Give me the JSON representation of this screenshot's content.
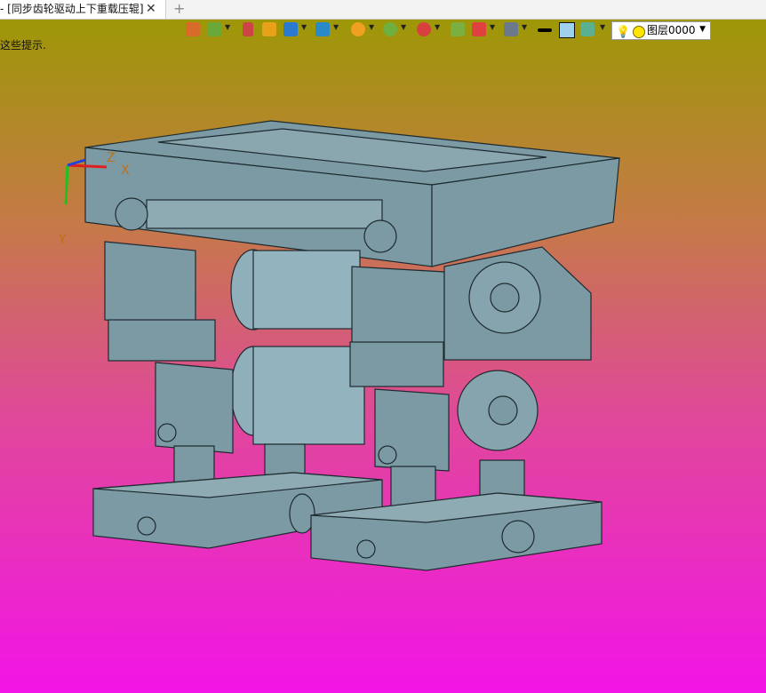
{
  "tab": {
    "title": "- [同步齿轮驱动上下重载压辊]",
    "close": "✕",
    "new": "+"
  },
  "status_hint": "这些提示.",
  "layer": {
    "value": "图层0000"
  },
  "axes": {
    "x": "X",
    "y": "Y",
    "z": "Z"
  },
  "toolbar_icons": [
    "views-icon",
    "plane-icon",
    "sketch-pen-icon",
    "extrude-icon",
    "solid-icon",
    "assembly-icon",
    "render-icon",
    "zoom-icon",
    "move-icon",
    "grid-icon",
    "section-icon",
    "display-icon",
    "line-width-icon",
    "color-box-icon",
    "surface-icon"
  ],
  "colors": {
    "model_fill": "#7b9aa4",
    "model_edge": "#1e2a30",
    "bg_top": "#9a9a00",
    "bg_bottom": "#f214e6"
  }
}
